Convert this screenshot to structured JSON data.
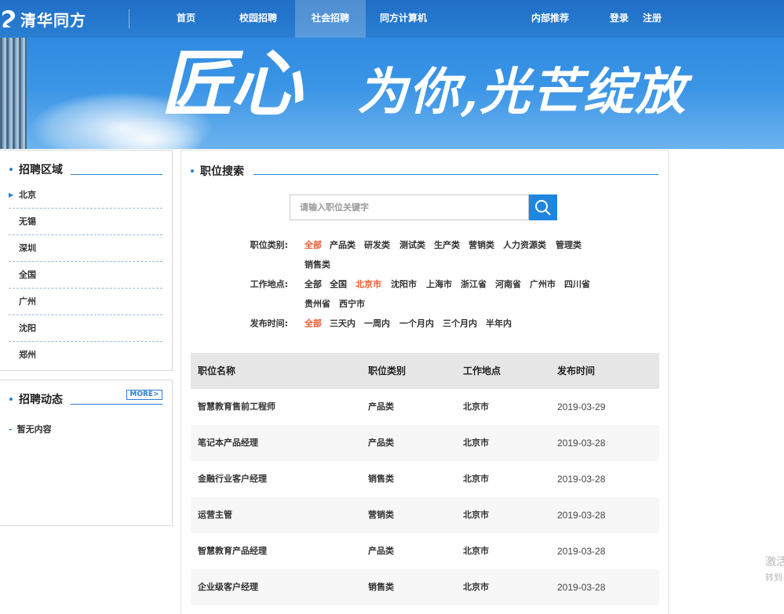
{
  "brand": {
    "name": "清华同方"
  },
  "nav": {
    "home": "首页",
    "campus": "校园招聘",
    "social": "社会招聘",
    "computer": "同方计算机",
    "referral": "内部推荐",
    "login": "登录",
    "register": "注册"
  },
  "banner": {
    "big": "匠心",
    "small": "为你,光芒绽放"
  },
  "region_panel": {
    "title": "招聘区域",
    "items": [
      {
        "label": "北京"
      },
      {
        "label": "无锡"
      },
      {
        "label": "深圳"
      },
      {
        "label": "全国"
      },
      {
        "label": "广州"
      },
      {
        "label": "沈阳"
      },
      {
        "label": "郑州"
      }
    ]
  },
  "news_panel": {
    "title": "招聘动态",
    "more": "MORE>",
    "empty": "暂无内容"
  },
  "search": {
    "title": "职位搜索",
    "placeholder": "请输入职位关键字",
    "value": ""
  },
  "filters": {
    "category": {
      "label": "职位类别:",
      "options": [
        "全部",
        "产品类",
        "研发类",
        "测试类",
        "生产类",
        "营销类",
        "人力资源类",
        "管理类",
        "销售类"
      ],
      "selected": "全部"
    },
    "location": {
      "label": "工作地点:",
      "options": [
        "全部",
        "全国",
        "北京市",
        "沈阳市",
        "上海市",
        "浙江省",
        "河南省",
        "广州市",
        "四川省",
        "贵州省",
        "西宁市"
      ],
      "selected": "北京市"
    },
    "time": {
      "label": "发布时间:",
      "options": [
        "全部",
        "三天内",
        "一周内",
        "一个月内",
        "三个月内",
        "半年内"
      ],
      "selected": "全部"
    }
  },
  "table": {
    "headers": {
      "name": "职位名称",
      "category": "职位类别",
      "location": "工作地点",
      "date": "发布时间"
    },
    "rows": [
      {
        "name": "智慧教育售前工程师",
        "category": "产品类",
        "location": "北京市",
        "date": "2019-03-29"
      },
      {
        "name": "笔记本产品经理",
        "category": "产品类",
        "location": "北京市",
        "date": "2019-03-28"
      },
      {
        "name": "金融行业客户经理",
        "category": "销售类",
        "location": "北京市",
        "date": "2019-03-28"
      },
      {
        "name": "运营主管",
        "category": "营销类",
        "location": "北京市",
        "date": "2019-03-28"
      },
      {
        "name": "智慧教育产品经理",
        "category": "产品类",
        "location": "北京市",
        "date": "2019-03-28"
      },
      {
        "name": "企业级客户经理",
        "category": "销售类",
        "location": "北京市",
        "date": "2019-03-28"
      }
    ]
  },
  "watermark": {
    "line1": "激活",
    "line2": "转到"
  },
  "colors": {
    "nav_bg": "#2a7fd2",
    "accent": "#1f86de",
    "selected": "#ef5c2e"
  }
}
